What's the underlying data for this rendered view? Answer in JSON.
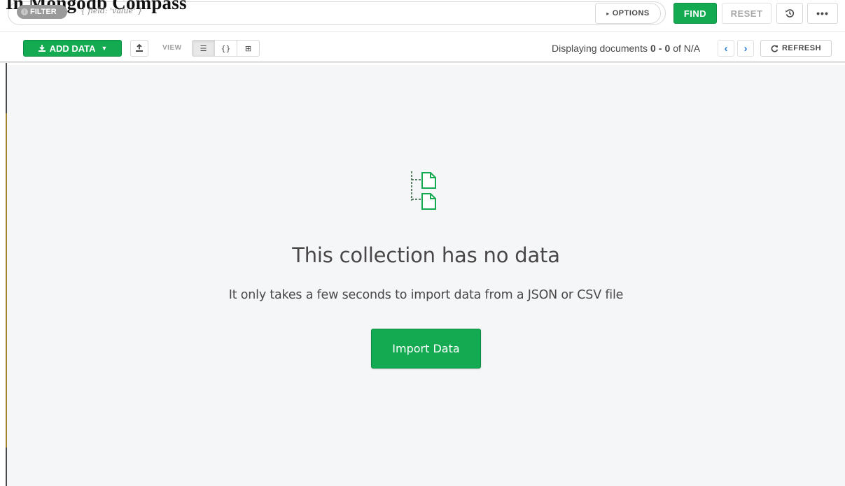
{
  "page": {
    "heading": "In Mongodb Compass"
  },
  "query_bar": {
    "filter_badge": "FILTER",
    "filter_placeholder": "{ field: 'value' }",
    "options_label": "OPTIONS",
    "find_label": "FIND",
    "reset_label": "RESET",
    "history_icon": "history-icon",
    "more_label": "•••"
  },
  "toolbar": {
    "add_data_label": "ADD DATA",
    "add_data_icon": "download-icon",
    "export_icon": "upload-icon",
    "view_label": "VIEW",
    "views": [
      {
        "name": "list",
        "icon": "list-icon",
        "glyph": "☰",
        "active": true
      },
      {
        "name": "json",
        "icon": "braces-icon",
        "glyph": "{}",
        "active": false
      },
      {
        "name": "table",
        "icon": "table-icon",
        "glyph": "⊞",
        "active": false
      }
    ],
    "displaying_prefix": "Displaying documents",
    "range_start": "0",
    "range_sep": "-",
    "range_end": "0",
    "of_text": "of N/A",
    "prev_glyph": "‹",
    "next_glyph": "›",
    "refresh_label": "REFRESH"
  },
  "empty_state": {
    "title": "This collection has no data",
    "subtitle": "It only takes a few seconds to import data from a JSON or CSV file",
    "button_label": "Import Data"
  },
  "colors": {
    "accent_green": "#13aa52",
    "pager_blue": "#2b7fd4",
    "background": "#f5f6f7"
  }
}
